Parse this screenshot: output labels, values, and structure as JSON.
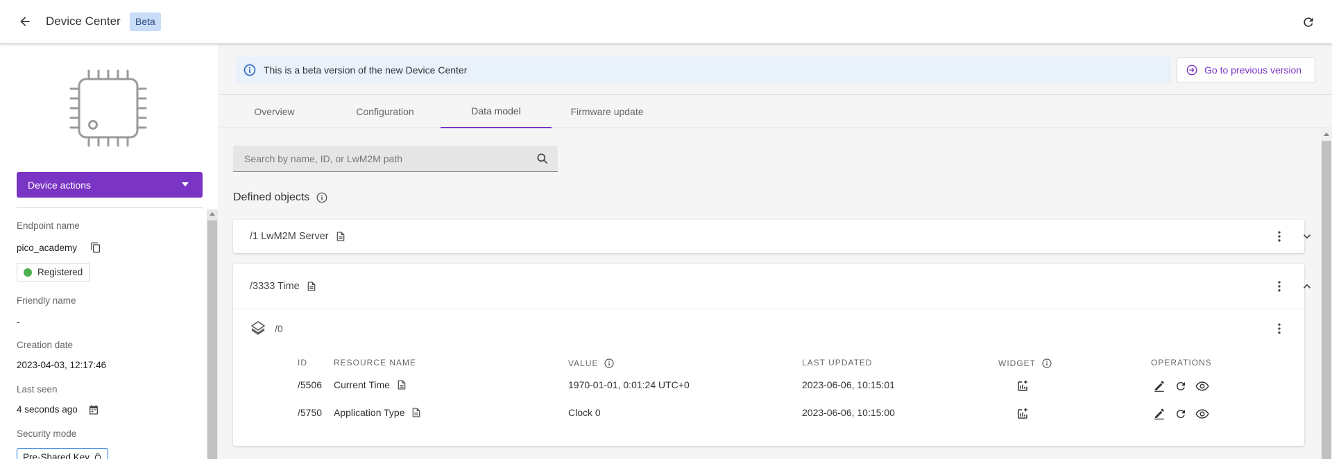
{
  "header": {
    "title": "Device Center",
    "badge": "Beta"
  },
  "sidebar": {
    "device_actions_label": "Device actions",
    "endpoint": {
      "label": "Endpoint name",
      "value": "pico_academy",
      "status": "Registered"
    },
    "friendly": {
      "label": "Friendly name",
      "value": "-"
    },
    "creation": {
      "label": "Creation date",
      "value": "2023-04-03, 12:17:46"
    },
    "last_seen": {
      "label": "Last seen",
      "value": "4 seconds ago"
    },
    "security": {
      "label": "Security mode",
      "value": "Pre-Shared Key"
    }
  },
  "banner": {
    "text": "This is a beta version of the new Device Center",
    "button": "Go to previous version"
  },
  "tabs": [
    {
      "label": "Overview"
    },
    {
      "label": "Configuration"
    },
    {
      "label": "Data model"
    },
    {
      "label": "Firmware update"
    }
  ],
  "search": {
    "placeholder": "Search by name, ID, or LwM2M path",
    "value": ""
  },
  "defined_objects": {
    "title": "Defined objects"
  },
  "objects": [
    {
      "title": "/1 LwM2M Server"
    },
    {
      "title": "/3333 Time",
      "instance": "/0",
      "columns": {
        "id": "ID",
        "name": "RESOURCE NAME",
        "value": "VALUE",
        "updated": "LAST UPDATED",
        "widget": "WIDGET",
        "ops": "OPERATIONS"
      },
      "rows": [
        {
          "id": "/5506",
          "name": "Current Time",
          "value": "1970-01-01, 0:01:24 UTC+0",
          "updated": "2023-06-06, 10:15:01"
        },
        {
          "id": "/5750",
          "name": "Application Type",
          "value": "Clock 0",
          "updated": "2023-06-06, 10:15:00"
        }
      ]
    }
  ],
  "colors": {
    "accent": "#7b35c4",
    "banner_bg": "#e9f1fb",
    "status_ok": "#4caf50"
  }
}
